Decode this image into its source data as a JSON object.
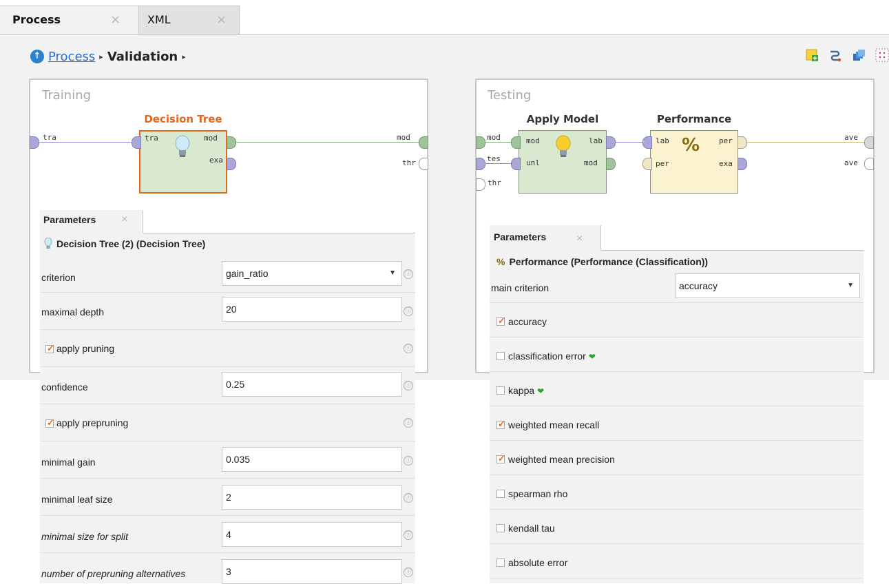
{
  "tabs": [
    {
      "label": "Process",
      "close": "×"
    },
    {
      "label": "XML",
      "close": "×"
    }
  ],
  "breadcrumb": {
    "root": "Process",
    "current": "Validation",
    "sep": "▸"
  },
  "colors": {
    "accent_orange": "#e2681b",
    "link_blue": "#2c6fcf",
    "checkmark_green": "#2aa52a"
  },
  "toolbar_icons": [
    "add-note-icon",
    "auto-wire-icon",
    "layers-icon",
    "grid-icon"
  ],
  "training": {
    "title": "Training",
    "left_port": "tra",
    "right_ports": [
      "mod",
      "thr"
    ],
    "operator": {
      "name": "Decision Tree",
      "in": [
        "tra"
      ],
      "out": [
        "mod",
        "exa"
      ],
      "icon": "lightbulb-icon"
    }
  },
  "testing": {
    "title": "Testing",
    "left_ports": [
      "mod",
      "tes",
      "thr"
    ],
    "right_ports": [
      "ave",
      "ave"
    ],
    "apply": {
      "name": "Apply Model",
      "in": [
        "mod",
        "unl"
      ],
      "out": [
        "lab",
        "mod"
      ],
      "icon": "lightbulb-icon"
    },
    "performance": {
      "name": "Performance",
      "in": [
        "lab",
        "per"
      ],
      "out": [
        "per",
        "exa"
      ],
      "icon": "percent-icon"
    }
  },
  "params_left": {
    "tab": "Parameters",
    "close": "×",
    "header": "Decision Tree (2) (Decision Tree)",
    "info": "ⓘ",
    "rows": [
      {
        "label": "criterion",
        "type": "select",
        "value": "gain_ratio"
      },
      {
        "label": "maximal depth",
        "type": "text",
        "value": "20"
      },
      {
        "label": "apply pruning",
        "type": "check",
        "checked": true
      },
      {
        "label": "confidence",
        "type": "text",
        "value": "0.25"
      },
      {
        "label": "apply prepruning",
        "type": "check",
        "checked": true
      },
      {
        "label": "minimal gain",
        "type": "text",
        "value": "0.035"
      },
      {
        "label": "minimal leaf size",
        "type": "text",
        "value": "2"
      },
      {
        "label": "minimal size for split",
        "type": "text",
        "value": "4",
        "italic": true
      },
      {
        "label": "number of prepruning alternatives",
        "type": "text",
        "value": "3",
        "italic": true
      }
    ]
  },
  "params_right": {
    "tab": "Parameters",
    "close": "×",
    "header": "Performance (Performance (Classification))",
    "main_criterion": {
      "label": "main criterion",
      "value": "accuracy"
    },
    "checks": [
      {
        "label": "accuracy",
        "checked": true
      },
      {
        "label": "classification error",
        "checked": false,
        "heart": true
      },
      {
        "label": "kappa",
        "checked": false,
        "heart": true
      },
      {
        "label": "weighted mean recall",
        "checked": true
      },
      {
        "label": "weighted mean precision",
        "checked": true
      },
      {
        "label": "spearman rho",
        "checked": false
      },
      {
        "label": "kendall tau",
        "checked": false
      },
      {
        "label": "absolute error",
        "checked": false
      }
    ]
  }
}
